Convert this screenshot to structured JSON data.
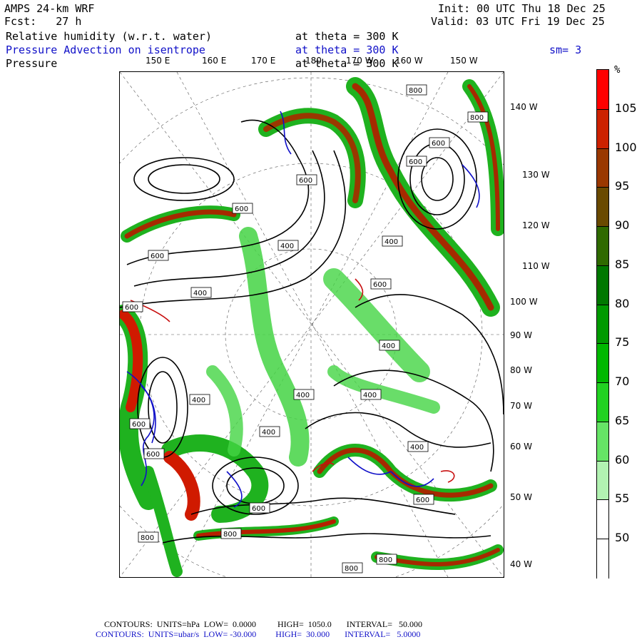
{
  "header": {
    "model": "AMPS 24-km WRF",
    "fcst": "Fcst:   27 h",
    "init": "Init: 00 UTC Thu 18 Dec 25",
    "valid": "Valid: 03 UTC Fri 19 Dec 25",
    "field1": "Relative humidity (w.r.t. water)",
    "field1_level": "at theta = 300 K",
    "field2": "Pressure Advection on isentrope",
    "field2_level": "at theta = 300 K",
    "smooth": "sm= 3",
    "field3": "Pressure",
    "field3_level": "at theta = 300 K"
  },
  "top_longitudes": [
    "150 E",
    "160 E",
    "170 E",
    "180",
    "170 W",
    "160 W",
    "150 W"
  ],
  "right_longitudes": [
    "140 W",
    "130 W",
    "120 W",
    "110 W",
    "100 W",
    "90 W",
    "80 W",
    "70 W",
    "60 W",
    "50 W",
    "40 W"
  ],
  "colorbar": {
    "unit": "%",
    "labels": [
      "105",
      "100",
      "95",
      "90",
      "85",
      "80",
      "75",
      "70",
      "65",
      "60",
      "55",
      "50"
    ],
    "colors": [
      "#ff0000",
      "#cc2200",
      "#9a3800",
      "#6a4a00",
      "#2f6a00",
      "#007800",
      "#009a00",
      "#00b800",
      "#22d222",
      "#66e466",
      "#b2f2b2",
      "#ffffff",
      "#ffffff"
    ]
  },
  "contour_labels": [
    "800",
    "800",
    "600",
    "600",
    "600",
    "600",
    "600",
    "400",
    "600",
    "400",
    "600",
    "400",
    "400",
    "400",
    "400",
    "400",
    "600",
    "400",
    "600",
    "800",
    "800",
    "800",
    "800",
    "600",
    "600",
    "400"
  ],
  "footer": {
    "line1": "CONTOURS:  UNITS=hPa  LOW=  0.0000          HIGH=  1050.0       INTERVAL=   50.000",
    "line2": "CONTOURS:  UNITS=ubar/s  LOW= -30.000         HIGH=  30.000       INTERVAL=   5.0000"
  }
}
